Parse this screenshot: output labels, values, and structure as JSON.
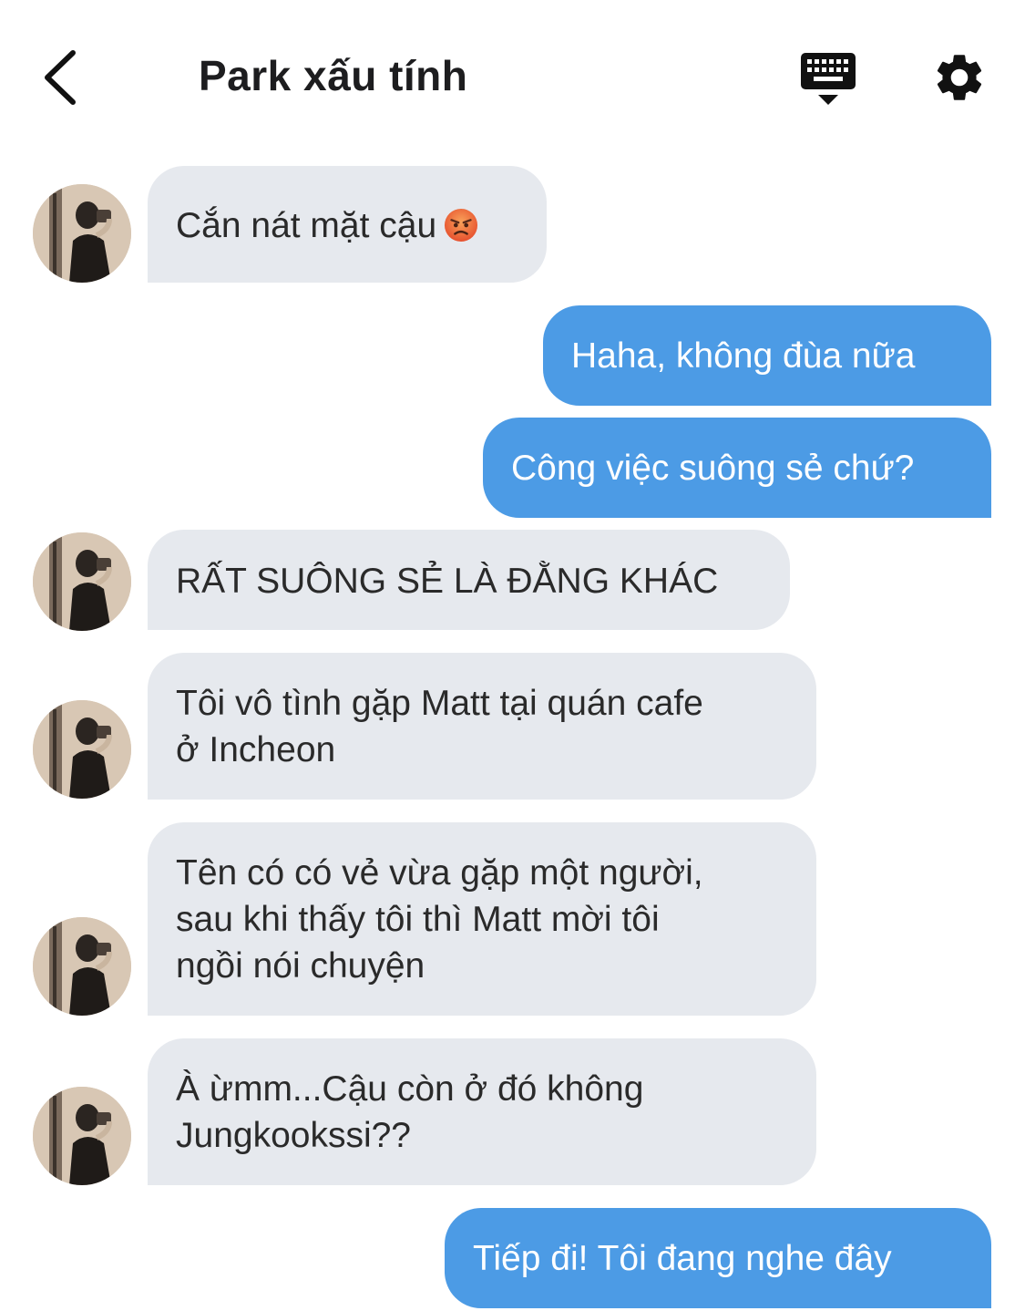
{
  "header": {
    "title": "Park xấu tính",
    "back_icon": "chevron-left-icon",
    "keyboard_icon": "keyboard-icon",
    "settings_icon": "gear-icon"
  },
  "messages": [
    {
      "side": "incoming",
      "text": "Cắn nát mặt cậu",
      "emoji": "angry-face"
    },
    {
      "side": "outgoing",
      "text": "Haha, không đùa nữa"
    },
    {
      "side": "outgoing",
      "text": "Công việc suông sẻ chứ?"
    },
    {
      "side": "incoming",
      "text": "RẤT SUÔNG SẺ LÀ ĐẰNG KHÁC"
    },
    {
      "side": "incoming",
      "text": "Tôi vô tình gặp Matt tại quán cafe\nở Incheon"
    },
    {
      "side": "incoming",
      "text": "Tên có có vẻ vừa gặp một người,\nsau khi thấy tôi thì Matt mời tôi\nngồi nói chuyện"
    },
    {
      "side": "incoming",
      "text": "À ừmm...Cậu còn ở đó không\nJungkookssi??"
    },
    {
      "side": "outgoing",
      "text": "Tiếp đi! Tôi đang nghe đây"
    }
  ],
  "colors": {
    "incoming_bubble": "#e6e9ee",
    "outgoing_bubble": "#4c9be5",
    "incoming_text": "#2a2a2a",
    "outgoing_text": "#ffffff"
  }
}
